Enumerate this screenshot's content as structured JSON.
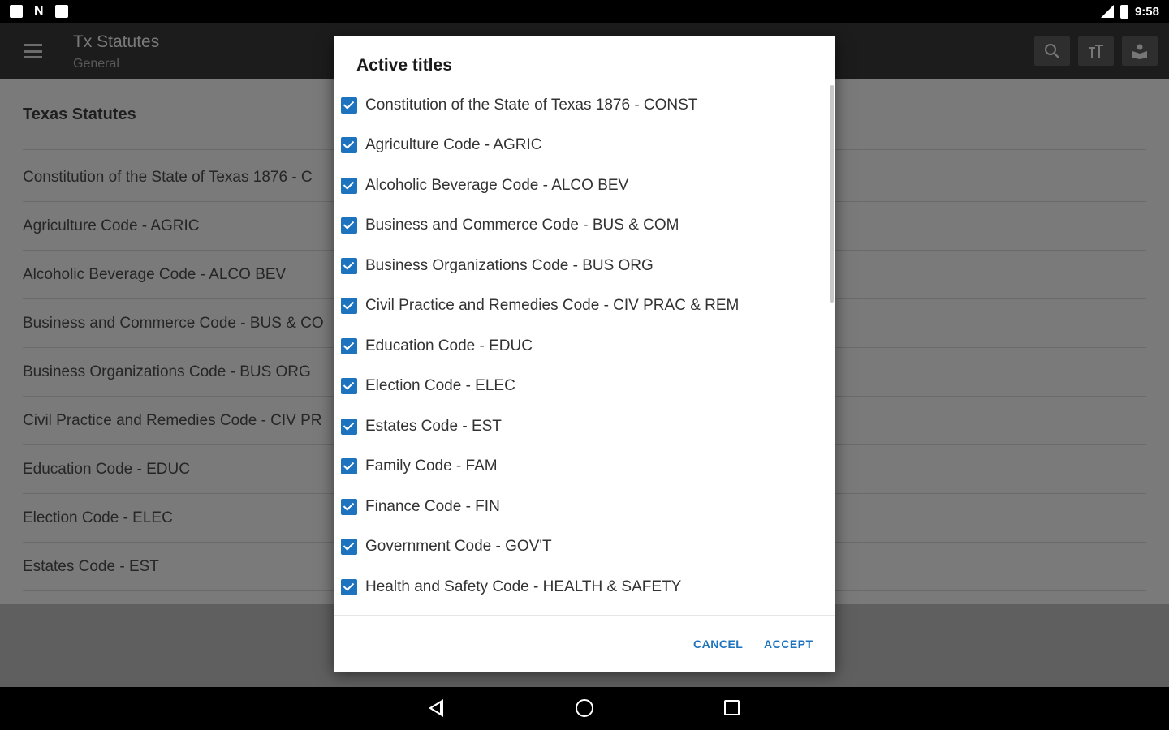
{
  "status_bar": {
    "time": "9:58",
    "left_icons": [
      "clipboard-icon",
      "n-icon",
      "square-notification-icon"
    ],
    "right_icons": [
      "signal-icon",
      "battery-icon"
    ]
  },
  "app_bar": {
    "title": "Tx Statutes",
    "subtitle": "General",
    "actions": [
      "search-icon",
      "text-size-icon",
      "reader-icon"
    ]
  },
  "content": {
    "title": "Texas Statutes",
    "items": [
      "Constitution of the State of Texas 1876 - C",
      "Agriculture Code - AGRIC",
      "Alcoholic Beverage Code - ALCO BEV",
      "Business and Commerce Code - BUS & CO",
      "Business Organizations Code - BUS ORG",
      "Civil Practice and Remedies Code - CIV PR",
      "Education Code - EDUC",
      "Election Code - ELEC",
      "Estates Code - EST"
    ]
  },
  "dialog": {
    "title": "Active titles",
    "items": [
      {
        "label": "Constitution of the State of Texas 1876 - CONST",
        "checked": true
      },
      {
        "label": "Agriculture Code - AGRIC",
        "checked": true
      },
      {
        "label": "Alcoholic Beverage Code - ALCO BEV",
        "checked": true
      },
      {
        "label": "Business and Commerce Code - BUS & COM",
        "checked": true
      },
      {
        "label": "Business Organizations Code - BUS ORG",
        "checked": true
      },
      {
        "label": "Civil Practice and Remedies Code - CIV PRAC & REM",
        "checked": true
      },
      {
        "label": "Education Code - EDUC",
        "checked": true
      },
      {
        "label": "Election Code - ELEC",
        "checked": true
      },
      {
        "label": "Estates Code - EST",
        "checked": true
      },
      {
        "label": "Family Code - FAM",
        "checked": true
      },
      {
        "label": "Finance Code - FIN",
        "checked": true
      },
      {
        "label": "Government Code - GOV'T",
        "checked": true
      },
      {
        "label": "Health and Safety Code - HEALTH & SAFETY",
        "checked": true
      }
    ],
    "cancel_label": "CANCEL",
    "accept_label": "ACCEPT"
  },
  "colors": {
    "accent": "#1e73be",
    "app_bar": "#1c1c1c",
    "scrim_content": "#7a7a7a"
  }
}
